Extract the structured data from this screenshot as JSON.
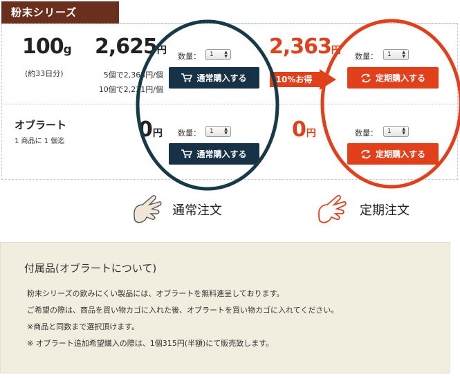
{
  "series_tab": {
    "label": "粉末シリーズ"
  },
  "product": {
    "weight_num": "100",
    "weight_unit": "g",
    "portion": "(約33日分)",
    "price_normal_num": "2,625",
    "price_normal_unit": "円",
    "bulk_line_1": "5個で2,363円/個",
    "bulk_line_2": "10個で2,231円/個",
    "price_sub_num": "2,363",
    "price_sub_unit": "円",
    "discount_badge": "10%お得"
  },
  "oblate": {
    "name": "オブラート",
    "note": "1 商品に 1 個迄",
    "price_normal_num": "0",
    "price_normal_unit": "円",
    "price_sub_num": "0",
    "price_sub_unit": "円"
  },
  "qty": {
    "label": "数量：",
    "value": "1"
  },
  "buttons": {
    "normal_label": "通常購入する",
    "sub_label": "定期購入する"
  },
  "captions": {
    "normal": "通常注文",
    "sub": "定期注文"
  },
  "info": {
    "title": "付属品(オブラートについて)",
    "lines": [
      "粉末シリーズの飲みにくい製品には、オブラートを無料進呈しております。",
      "ご希望の際は、商品を買い物カゴに入れた後、オブラートを買い物カゴに入れてください。",
      "※商品と同数まで選択頂けます。",
      "※ オブラート追加希望購入の際は、1個315円(半額)にて販売致します。"
    ]
  },
  "colors": {
    "accent_orange": "#e2401b",
    "navy": "#173246",
    "tab_brown": "#6b2f1d",
    "info_bg": "#f1eedf"
  },
  "icons": [
    "cart-icon",
    "refresh-icon",
    "arrow-right-icon",
    "pointing-hand-icon"
  ]
}
